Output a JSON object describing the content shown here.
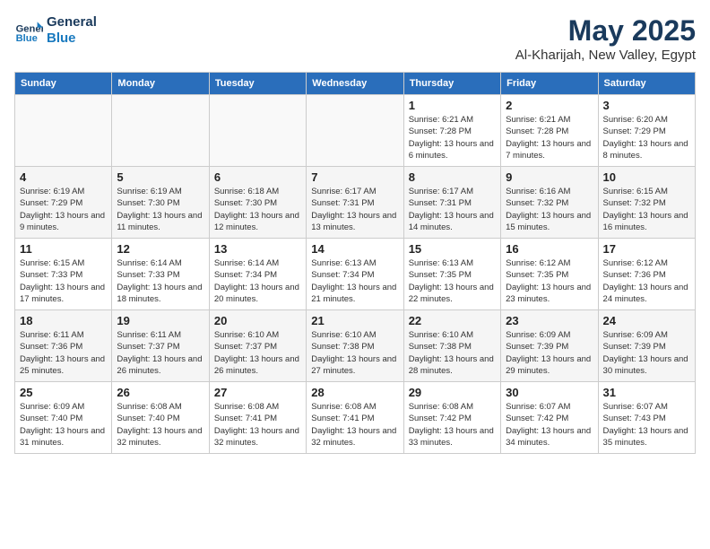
{
  "logo": {
    "line1": "General",
    "line2": "Blue"
  },
  "title": "May 2025",
  "location": "Al-Kharijah, New Valley, Egypt",
  "weekdays": [
    "Sunday",
    "Monday",
    "Tuesday",
    "Wednesday",
    "Thursday",
    "Friday",
    "Saturday"
  ],
  "weeks": [
    [
      {
        "day": "",
        "info": ""
      },
      {
        "day": "",
        "info": ""
      },
      {
        "day": "",
        "info": ""
      },
      {
        "day": "",
        "info": ""
      },
      {
        "day": "1",
        "info": "Sunrise: 6:21 AM\nSunset: 7:28 PM\nDaylight: 13 hours and 6 minutes."
      },
      {
        "day": "2",
        "info": "Sunrise: 6:21 AM\nSunset: 7:28 PM\nDaylight: 13 hours and 7 minutes."
      },
      {
        "day": "3",
        "info": "Sunrise: 6:20 AM\nSunset: 7:29 PM\nDaylight: 13 hours and 8 minutes."
      }
    ],
    [
      {
        "day": "4",
        "info": "Sunrise: 6:19 AM\nSunset: 7:29 PM\nDaylight: 13 hours and 9 minutes."
      },
      {
        "day": "5",
        "info": "Sunrise: 6:19 AM\nSunset: 7:30 PM\nDaylight: 13 hours and 11 minutes."
      },
      {
        "day": "6",
        "info": "Sunrise: 6:18 AM\nSunset: 7:30 PM\nDaylight: 13 hours and 12 minutes."
      },
      {
        "day": "7",
        "info": "Sunrise: 6:17 AM\nSunset: 7:31 PM\nDaylight: 13 hours and 13 minutes."
      },
      {
        "day": "8",
        "info": "Sunrise: 6:17 AM\nSunset: 7:31 PM\nDaylight: 13 hours and 14 minutes."
      },
      {
        "day": "9",
        "info": "Sunrise: 6:16 AM\nSunset: 7:32 PM\nDaylight: 13 hours and 15 minutes."
      },
      {
        "day": "10",
        "info": "Sunrise: 6:15 AM\nSunset: 7:32 PM\nDaylight: 13 hours and 16 minutes."
      }
    ],
    [
      {
        "day": "11",
        "info": "Sunrise: 6:15 AM\nSunset: 7:33 PM\nDaylight: 13 hours and 17 minutes."
      },
      {
        "day": "12",
        "info": "Sunrise: 6:14 AM\nSunset: 7:33 PM\nDaylight: 13 hours and 18 minutes."
      },
      {
        "day": "13",
        "info": "Sunrise: 6:14 AM\nSunset: 7:34 PM\nDaylight: 13 hours and 20 minutes."
      },
      {
        "day": "14",
        "info": "Sunrise: 6:13 AM\nSunset: 7:34 PM\nDaylight: 13 hours and 21 minutes."
      },
      {
        "day": "15",
        "info": "Sunrise: 6:13 AM\nSunset: 7:35 PM\nDaylight: 13 hours and 22 minutes."
      },
      {
        "day": "16",
        "info": "Sunrise: 6:12 AM\nSunset: 7:35 PM\nDaylight: 13 hours and 23 minutes."
      },
      {
        "day": "17",
        "info": "Sunrise: 6:12 AM\nSunset: 7:36 PM\nDaylight: 13 hours and 24 minutes."
      }
    ],
    [
      {
        "day": "18",
        "info": "Sunrise: 6:11 AM\nSunset: 7:36 PM\nDaylight: 13 hours and 25 minutes."
      },
      {
        "day": "19",
        "info": "Sunrise: 6:11 AM\nSunset: 7:37 PM\nDaylight: 13 hours and 26 minutes."
      },
      {
        "day": "20",
        "info": "Sunrise: 6:10 AM\nSunset: 7:37 PM\nDaylight: 13 hours and 26 minutes."
      },
      {
        "day": "21",
        "info": "Sunrise: 6:10 AM\nSunset: 7:38 PM\nDaylight: 13 hours and 27 minutes."
      },
      {
        "day": "22",
        "info": "Sunrise: 6:10 AM\nSunset: 7:38 PM\nDaylight: 13 hours and 28 minutes."
      },
      {
        "day": "23",
        "info": "Sunrise: 6:09 AM\nSunset: 7:39 PM\nDaylight: 13 hours and 29 minutes."
      },
      {
        "day": "24",
        "info": "Sunrise: 6:09 AM\nSunset: 7:39 PM\nDaylight: 13 hours and 30 minutes."
      }
    ],
    [
      {
        "day": "25",
        "info": "Sunrise: 6:09 AM\nSunset: 7:40 PM\nDaylight: 13 hours and 31 minutes."
      },
      {
        "day": "26",
        "info": "Sunrise: 6:08 AM\nSunset: 7:40 PM\nDaylight: 13 hours and 32 minutes."
      },
      {
        "day": "27",
        "info": "Sunrise: 6:08 AM\nSunset: 7:41 PM\nDaylight: 13 hours and 32 minutes."
      },
      {
        "day": "28",
        "info": "Sunrise: 6:08 AM\nSunset: 7:41 PM\nDaylight: 13 hours and 32 minutes."
      },
      {
        "day": "29",
        "info": "Sunrise: 6:08 AM\nSunset: 7:42 PM\nDaylight: 13 hours and 33 minutes."
      },
      {
        "day": "30",
        "info": "Sunrise: 6:07 AM\nSunset: 7:42 PM\nDaylight: 13 hours and 34 minutes."
      },
      {
        "day": "31",
        "info": "Sunrise: 6:07 AM\nSunset: 7:43 PM\nDaylight: 13 hours and 35 minutes."
      }
    ]
  ]
}
